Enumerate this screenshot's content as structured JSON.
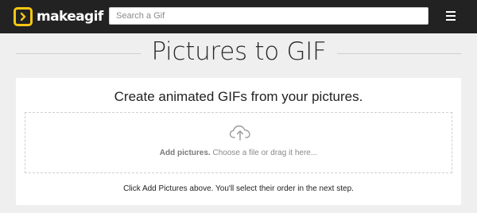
{
  "header": {
    "logo_text": "makeagif",
    "search_placeholder": "Search a Gif",
    "menu_icon": "hamburger-menu-icon"
  },
  "page": {
    "title": "Pictures to GIF"
  },
  "panel": {
    "title": "Create animated GIFs from your pictures.",
    "dropzone": {
      "icon": "cloud-upload-icon",
      "action_label": "Add pictures.",
      "instruction": "Choose a file or drag it here..."
    },
    "hint": "Click Add Pictures above. You'll select their order in the next step."
  },
  "colors": {
    "topbar": "#222222",
    "logo_accent": "#f7c613",
    "background": "#efefef",
    "panel": "#ffffff"
  }
}
